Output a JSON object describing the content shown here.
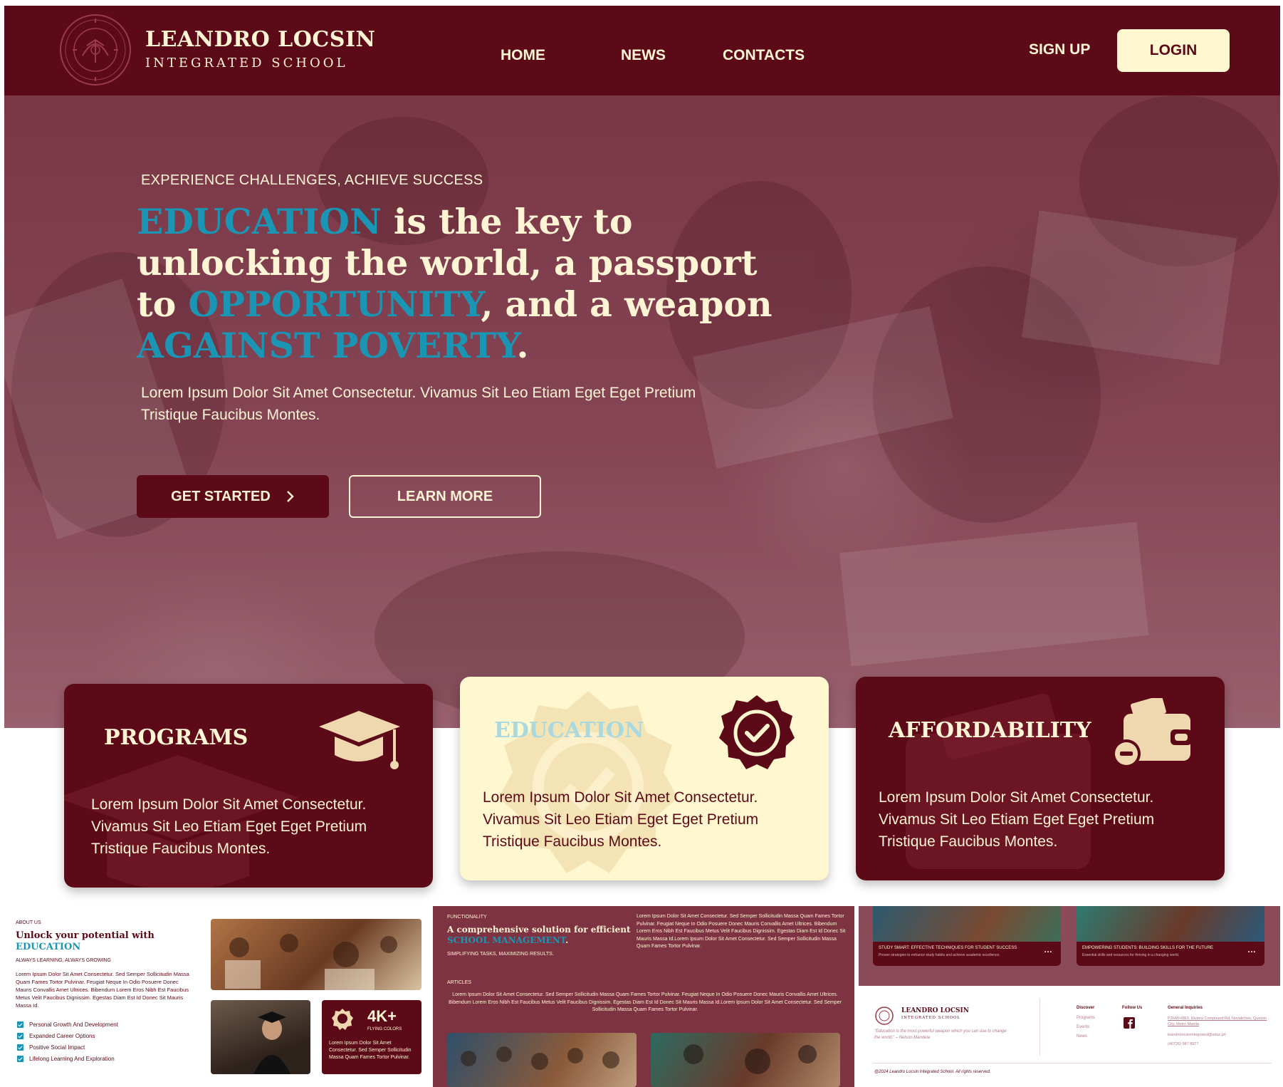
{
  "header": {
    "brand_name": "LEANDRO LOCSIN",
    "brand_sub": "INTEGRATED SCHOOL",
    "nav": [
      "HOME",
      "NEWS",
      "CONTACTS"
    ],
    "signup": "SIGN UP",
    "login": "LOGIN"
  },
  "hero": {
    "eyebrow": "EXPERIENCE CHALLENGES, ACHIEVE SUCCESS",
    "title_parts": [
      "EDUCATION",
      " is the key to unlocking the world, a passport to ",
      "OPPORTUNITY",
      ", and a weapon ",
      "AGAINST POVERTY",
      "."
    ],
    "description": "Lorem Ipsum Dolor Sit Amet Consectetur. Vivamus Sit Leo Etiam Eget Eget Pretium Tristique Faucibus Montes.",
    "cta_primary": "GET STARTED",
    "cta_secondary": "LEARN MORE"
  },
  "cards": [
    {
      "title": "PROGRAMS",
      "text": "Lorem Ipsum Dolor Sit Amet Consectetur. Vivamus Sit Leo Etiam Eget Eget Pretium Tristique Faucibus Montes.",
      "icon": "graduation-cap-icon"
    },
    {
      "title": "EDUCATION",
      "text": "Lorem Ipsum Dolor Sit Amet Consectetur. Vivamus Sit Leo Etiam Eget Eget Pretium Tristique Faucibus Montes.",
      "icon": "verified-badge-icon"
    },
    {
      "title": "AFFORDABILITY",
      "text": "Lorem Ipsum Dolor Sit Amet Consectetur. Vivamus Sit Leo Etiam Eget Eget Pretium Tristique Faucibus Montes.",
      "icon": "wallet-icon"
    }
  ],
  "about": {
    "label": "ABOUT US",
    "heading": "Unlock your potential with",
    "heading_hl": "EDUCATION",
    "sub": "ALWAYS LEARNING, ALWAYS GROWING",
    "body": "Lorem Ipsum Dolor Sit Amet Consectetur. Sed Semper Sollicitudin Massa Quam Fames Tortor Pulvinar. Feugiat Neque In Odio Posuere Donec Mauris Convallis Amet Ultrices. Bibendum Lorem Eros Nibh Est Faucibus Metus Velit Faucibus Dignissim. Egestas Diam Est Id Donec Sit Mauris Massa Id.",
    "checklist": [
      "Personal Growth And Development",
      "Expanded Career Options",
      "Positive Social Impact",
      "Lifelong Learning And Exploration"
    ],
    "stat_value": "4K+",
    "stat_label": "FLYING COLORS",
    "stat_text": "Lorem Ipsum Dolor Sit Amet Consectetur. Sed Semper Sollicitudin Massa Quam Fames Tortor Pulvinar."
  },
  "functionality": {
    "label": "FUNCTIONALITY",
    "heading": "A comprehensive solution for efficient",
    "heading_hl": "SCHOOL MANAGEMENT",
    "heading_end": ".",
    "sub": "SIMPLIFYING TASKS, MAXIMIZING RESULTS.",
    "side_text": "Lorem Ipsum Dolor Sit Amet Consectetur. Sed Semper Sollicitudin Massa Quam Fames Tortor Pulvinar. Feugiat Neque In Odio Posuere Donec Mauris Convallis Amet Ultrices. Bibendum Lorem Eros Nibh Est Faucibus Metus Velit Faucibus Dignissim. Egestas Diam Est Id Donec Sit Mauris Massa Id.Lorem Ipsum Dolor Sit Amet Consectetur. Sed Semper Sollicitudin Massa Quam Fames Tortor Pulvinar.",
    "articles_label": "ARTICLES",
    "articles_text": "Lorem Ipsum Dolor Sit Amet Consectetur. Sed Semper Sollicitudin Massa Quam Fames Tortor Pulvinar. Feugiat Neque In Odio Posuere Donec Mauris Convallis Amet Ultrices. Bibendum Lorem Eros Nibh Est Faucibus Metus Velit Faucibus Dignissim. Egestas Diam Est Id Donec Sit Mauris Massa Id.Lorem Ipsum Dolor Sit Amet Consectetur. Sed Semper Sollicitudin Massa Quam Fames Tortor Pulvinar."
  },
  "articles": [
    {
      "title": "STUDY SMART: EFFECTIVE TECHNIQUES FOR STUDENT SUCCESS",
      "desc": "Proven strategies to enhance study habits and achieve academic excellence."
    },
    {
      "title": "EMPOWERING STUDENTS: BUILDING SKILLS FOR THE FUTURE",
      "desc": "Essential skills and resources for thriving in a changing world."
    }
  ],
  "footer": {
    "brand_name": "LEANDRO LOCSIN",
    "brand_sub": "INTEGRATED SCHOOL",
    "quote": "\"Education is the most powerful weapon which you can use to change the world.\" – Nelson Mandela",
    "discover_label": "Discover",
    "discover_links": [
      "Programs",
      "Events",
      "News"
    ],
    "follow_label": "Follow Us",
    "inquiries_label": "General Inquiries",
    "address": "P2HW+M63, Riviera Compound Rd, Novaliches, Quezon City, Metro Manila",
    "email": "leandrolocsinintegrated@educ.ph",
    "phone": "(46726) 987 8977",
    "copyright": "@2024 Leandro Locsin Integrated School. All rights reserved."
  },
  "colors": {
    "maroon": "#5c0a17",
    "cream": "#fff7cf",
    "accent": "#1b95b4",
    "hero_tint": "#854555"
  }
}
